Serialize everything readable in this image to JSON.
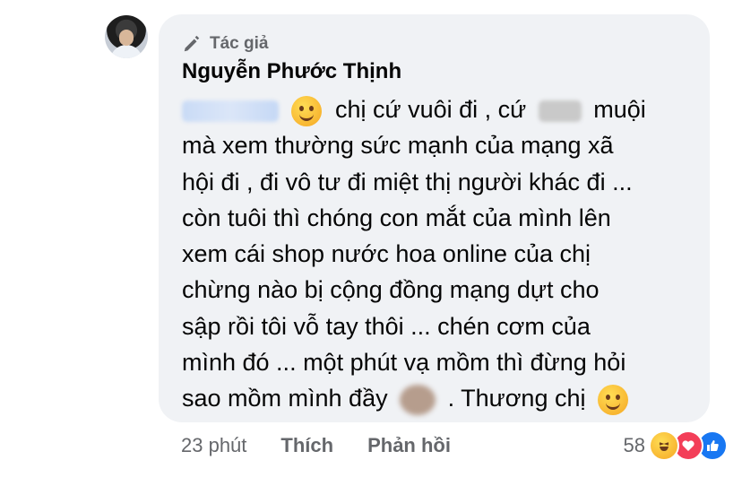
{
  "comment": {
    "author_badge": "Tác giả",
    "author_name": "Nguyễn Phước Thịnh",
    "text_lines": {
      "l1_a": "chị cứ vuôi đi , cứ",
      "l1_b": "muội",
      "l2": "mà xem thường sức mạnh của mạng xã",
      "l3": "hội đi , đi vô tư đi miệt thị người khác đi ...",
      "l4": "còn tuôi thì chóng con mắt của mình lên",
      "l5": "xem cái shop nước hoa online của chị",
      "l6": "chừng nào bị cộng đồng mạng dựt cho",
      "l7": "sập rồi tôi vỗ tay thôi ... chén cơm của",
      "l8": "mình đó ... một phút vạ mồm thì đừng hỏi",
      "l9_a": "sao mồm mình đầy",
      "l9_b": ". Thương chị"
    },
    "emojis": {
      "inline_1": "smiling-face-emoji",
      "inline_2": "winking-face-emoji"
    }
  },
  "footer": {
    "time": "23 phút",
    "like_action": "Thích",
    "reply_action": "Phản hồi",
    "reaction_count": "58",
    "reactions": [
      "haha-icon",
      "love-icon",
      "like-icon"
    ]
  },
  "colors": {
    "bubble_bg": "#f0f2f5",
    "text": "#050505",
    "secondary": "#65676b",
    "like_blue": "#1877f2",
    "love_red": "#f33e58"
  }
}
